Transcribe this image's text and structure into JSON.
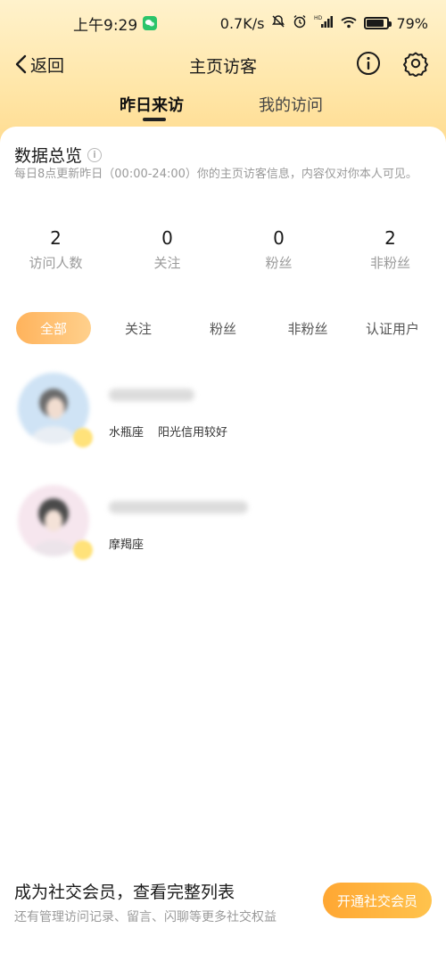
{
  "status_bar": {
    "time": "上午9:29",
    "network_speed": "0.7K/s",
    "network_type": "HD",
    "battery": "79%",
    "battery_level": 0.79
  },
  "navbar": {
    "back_label": "返回",
    "title": "主页访客"
  },
  "tabs": [
    {
      "label": "昨日来访",
      "active": true
    },
    {
      "label": "我的访问",
      "active": false
    }
  ],
  "overview": {
    "title": "数据总览",
    "info_glyph": "i",
    "description": "每日8点更新昨日（00:00-24:00）你的主页访客信息，内容仅对你本人可见。",
    "stats": [
      {
        "value": "2",
        "label": "访问人数"
      },
      {
        "value": "0",
        "label": "关注"
      },
      {
        "value": "0",
        "label": "粉丝"
      },
      {
        "value": "2",
        "label": "非粉丝"
      }
    ]
  },
  "filters": [
    {
      "label": "全部",
      "active": true
    },
    {
      "label": "关注",
      "active": false
    },
    {
      "label": "粉丝",
      "active": false
    },
    {
      "label": "非粉丝",
      "active": false
    },
    {
      "label": "认证用户",
      "active": false
    }
  ],
  "visitors": [
    {
      "tags": [
        "水瓶座",
        "阳光信用较好"
      ]
    },
    {
      "tags": [
        "摩羯座"
      ]
    }
  ],
  "promo": {
    "title": "成为社交会员，查看完整列表",
    "subtitle": "还有管理访问记录、留言、闪聊等更多社交权益",
    "button_label": "开通社交会员"
  },
  "colors": {
    "accent": "#ffad40",
    "header_gradient_top": "#fff2cc",
    "header_gradient_bottom": "#ffd98a"
  }
}
